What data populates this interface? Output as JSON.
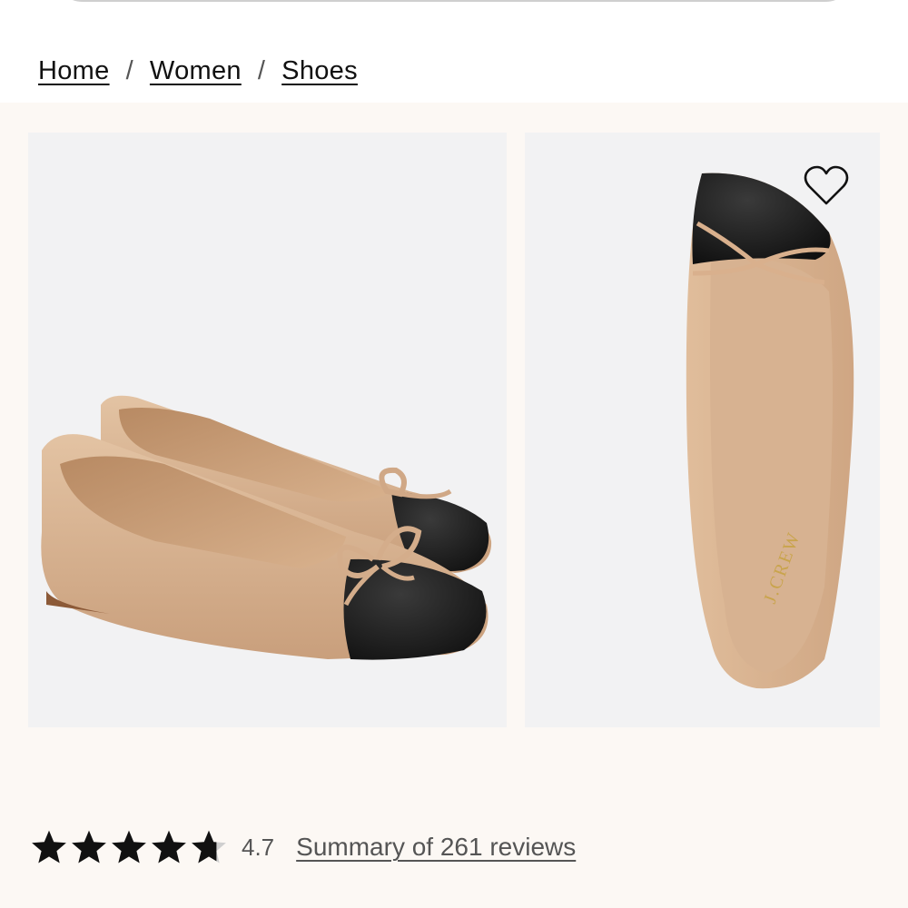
{
  "breadcrumb": {
    "items": [
      "Home",
      "Women",
      "Shoes"
    ],
    "separator": "/"
  },
  "gallery": {
    "image_1_alt": "Cap-toe ballet flats in tan and black, pair view",
    "image_2_alt": "Cap-toe ballet flat, top view",
    "insole_brand": "J.CREW",
    "wishlist_icon": "heart-outline-icon"
  },
  "rating": {
    "value": "4.7",
    "stars_filled": 4.7,
    "stars_total": 5,
    "reviews_link": "Summary of 261 reviews"
  },
  "colors": {
    "gallery_bg": "#fcf8f4",
    "photo_bg": "#f2f2f3",
    "tan": "#d8b492",
    "black_cap": "#1b1b1b"
  }
}
